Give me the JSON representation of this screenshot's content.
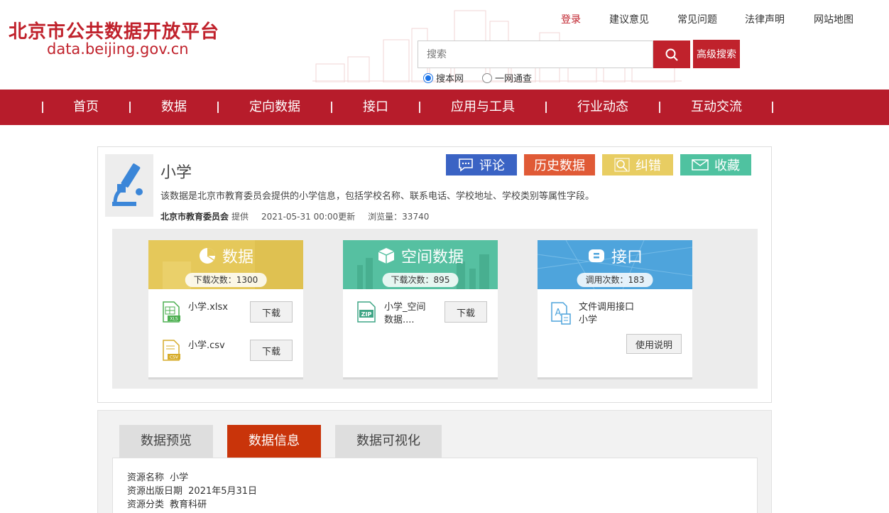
{
  "header": {
    "title": "北京市公共数据开放平台",
    "url": "data.beijing.gov.cn",
    "links": [
      "登录",
      "建议意见",
      "常见问题",
      "法律声明",
      "网站地图"
    ],
    "search_placeholder": "搜索",
    "advanced_search": "高级搜索",
    "scope_options": [
      "搜本网",
      "一网通查"
    ],
    "scope_selected": "搜本网",
    "accent_color": "#c0222c"
  },
  "nav": {
    "items": [
      "首页",
      "数据",
      "定向数据",
      "接口",
      "应用与工具",
      "行业动态",
      "互动交流"
    ]
  },
  "dataset": {
    "title": "小学",
    "description": "该数据是北京市教育委员会提供的小学信息，包括学校名称、联系电话、学校地址、学校类别等属性字段。",
    "provider": "北京市教育委员会",
    "provider_suffix": "提供",
    "updated": "2021-05-31 00:00更新",
    "views": "浏览量：33740",
    "actions": [
      {
        "label": "评论",
        "color": "#3a63c4",
        "icon": "comment-icon"
      },
      {
        "label": "历史数据",
        "color": "#e05a36"
      },
      {
        "label": "纠错",
        "color": "#e8cd62",
        "icon": "magnifier-icon"
      },
      {
        "label": "收藏",
        "color": "#4fc2a0",
        "icon": "envelope-icon"
      }
    ]
  },
  "cards": [
    {
      "title": "数据",
      "icon": "pie-chart-icon",
      "color": "#e5c85a",
      "counter": "下载次数：1300",
      "files": [
        {
          "name": "小学.xlsx",
          "icon": "xls-file-icon",
          "button": "下载"
        },
        {
          "name": "小学.csv",
          "icon": "csv-file-icon",
          "button": "下载"
        }
      ]
    },
    {
      "title": "空间数据",
      "icon": "cube-icon",
      "color": "#56c0a1",
      "counter": "下载次数：895",
      "files": [
        {
          "name": "小学_空间\n数据....",
          "icon": "zip-file-icon",
          "button": "下载"
        }
      ]
    },
    {
      "title": "接口",
      "icon": "api-icon",
      "color": "#4ea4dc",
      "counter": "调用次数：183",
      "files": [
        {
          "name": "文件调用接口\n小学",
          "icon": "api-doc-icon"
        }
      ],
      "usage_button": "使用说明"
    }
  ],
  "tabs": {
    "items": [
      "数据预览",
      "数据信息",
      "数据可视化"
    ],
    "active": "数据信息"
  },
  "info": {
    "rows": [
      {
        "label": "资源名称",
        "value": "小学"
      },
      {
        "label": "资源出版日期",
        "value": "2021年5月31日"
      },
      {
        "label": "资源分类",
        "value": "教育科研"
      }
    ]
  }
}
